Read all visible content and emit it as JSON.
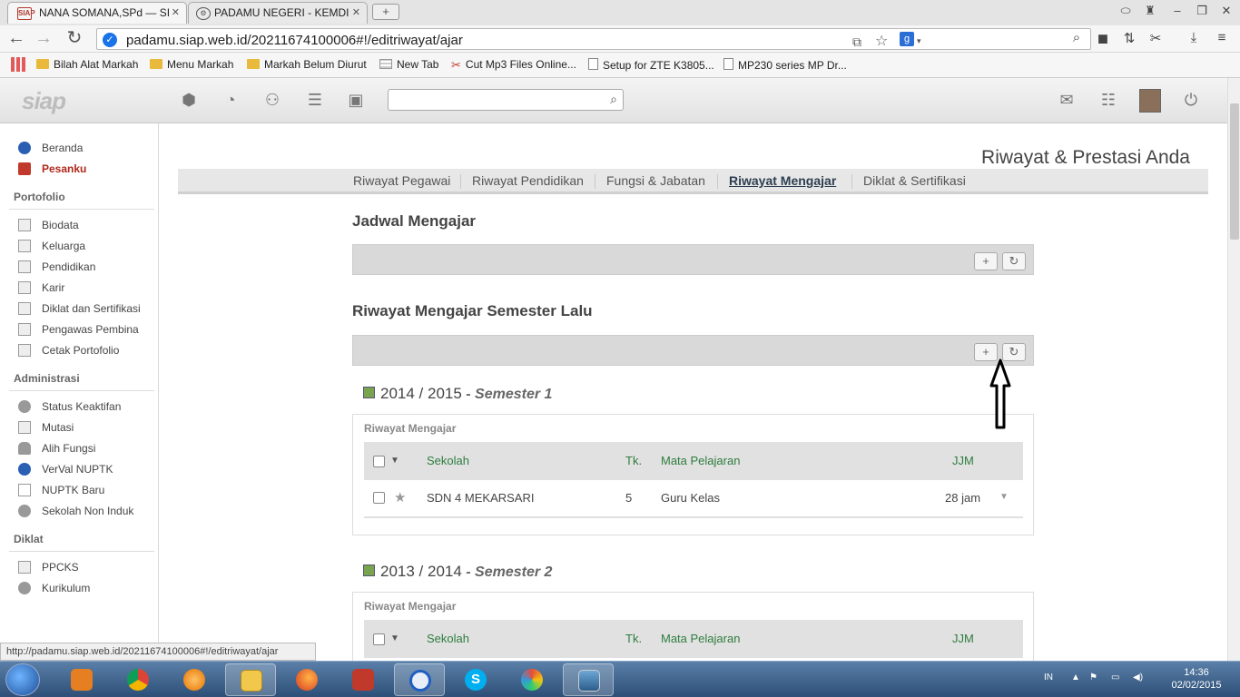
{
  "browser": {
    "tabs": [
      {
        "title": "NANA SOMANA,SPd — SI",
        "favicon": "SIAP"
      },
      {
        "title": "PADAMU NEGERI - KEMDI",
        "favicon": "logo"
      }
    ],
    "new_tab_symbol": "+",
    "url": "padamu.siap.web.id/20211674100006#!/editriwayat/ajar",
    "bookmarks": [
      {
        "label": "Bilah Alat Markah",
        "icon": "folder-icon"
      },
      {
        "label": "Menu Markah",
        "icon": "folder-icon"
      },
      {
        "label": "Markah Belum Diurut",
        "icon": "folder-icon"
      },
      {
        "label": "New Tab",
        "icon": "grid-icon"
      },
      {
        "label": "Cut Mp3 Files Online...",
        "icon": "scissors-icon"
      },
      {
        "label": "Setup for ZTE K3805...",
        "icon": "page-icon"
      },
      {
        "label": "MP230 series MP Dr...",
        "icon": "page-icon"
      }
    ]
  },
  "app": {
    "logo": "siap",
    "search_placeholder": ""
  },
  "sidebar": {
    "top": [
      {
        "label": "Beranda",
        "icon": "info-icon"
      },
      {
        "label": "Pesanku",
        "icon": "alert-icon"
      }
    ],
    "portofolio_heading": "Portofolio",
    "portofolio": [
      "Biodata",
      "Keluarga",
      "Pendidikan",
      "Karir",
      "Diklat dan Sertifikasi",
      "Pengawas Pembina",
      "Cetak Portofolio"
    ],
    "administrasi_heading": "Administrasi",
    "administrasi": [
      "Status Keaktifan",
      "Mutasi",
      "Alih Fungsi",
      "VerVal NUPTK",
      "NUPTK Baru",
      "Sekolah Non Induk"
    ],
    "diklat_heading": "Diklat",
    "diklat": [
      "PPCKS",
      "Kurikulum"
    ]
  },
  "status_url": "http://padamu.siap.web.id/20211674100006#!/editriwayat/ajar",
  "main": {
    "page_title": "Riwayat & Prestasi Anda",
    "subnav": [
      "Riwayat Pegawai",
      "Riwayat Pendidikan",
      "Fungsi & Jabatan",
      "Riwayat Mengajar",
      "Diklat & Sertifikasi"
    ],
    "active_subnav": "Riwayat Mengajar",
    "section1_title": "Jadwal Mengajar",
    "section2_title": "Riwayat Mengajar Semester Lalu",
    "add_symbol": "+",
    "refresh_symbol": "↻",
    "semesters": [
      {
        "year": "2014 / 2015",
        "sep": " - ",
        "semester": "Semester 1",
        "card_title": "Riwayat Mengajar",
        "columns": {
          "sekolah": "Sekolah",
          "tk": "Tk.",
          "mapel": "Mata Pelajaran",
          "jjm": "JJM"
        },
        "rows": [
          {
            "sekolah": "SDN 4 MEKARSARI",
            "tk": "5",
            "mapel": "Guru Kelas",
            "jjm": "28 jam"
          }
        ]
      },
      {
        "year": "2013 / 2014",
        "sep": " - ",
        "semester": "Semester 2",
        "card_title": "Riwayat Mengajar",
        "columns": {
          "sekolah": "Sekolah",
          "tk": "Tk.",
          "mapel": "Mata Pelajaran",
          "jjm": "JJM"
        },
        "rows": []
      }
    ]
  },
  "taskbar": {
    "language": "IN",
    "time": "14:36",
    "date": "02/02/2015"
  }
}
